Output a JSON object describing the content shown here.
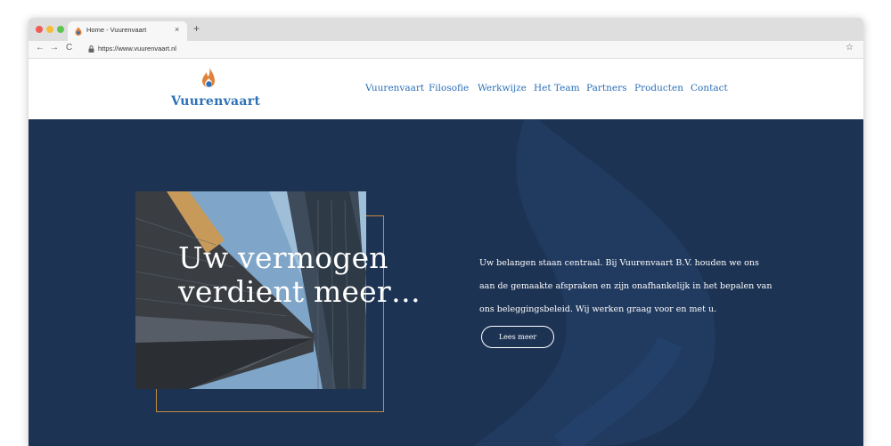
{
  "browser": {
    "tab_title": "Home - Vuurenvaart",
    "tab_close": "×",
    "new_tab": "+",
    "url": "https://www.vuurenvaart.nl",
    "back": "←",
    "forward": "→",
    "reload": "C",
    "bookmark": "☆",
    "icons": [
      "close-icon",
      "plus-icon",
      "back-arrow-icon",
      "forward-arrow-icon",
      "reload-icon",
      "lock-icon",
      "star-icon"
    ]
  },
  "header": {
    "logo_text": "Vuurenvaart",
    "nav": [
      "Vuurenvaart",
      "Filosofie",
      "Werkwijze",
      "Het Team",
      "Partners",
      "Producten",
      "Contact"
    ]
  },
  "hero": {
    "title_line1": "Uw vermogen",
    "title_line2": "verdient meer…",
    "body": "Uw belangen staan centraal. Bij Vuurenvaart B.V. houden we ons aan de gemaakte afspraken en zijn onafhankelijk in het bepalen van ons beleggingsbeleid. Wij werken graag voor en met u.",
    "button": "Lees meer"
  },
  "colors": {
    "brand_blue": "#2c70b7",
    "flame_orange": "#e0823a",
    "hero_navy": "#1d3354",
    "frame_gold": "#c88a3f"
  }
}
